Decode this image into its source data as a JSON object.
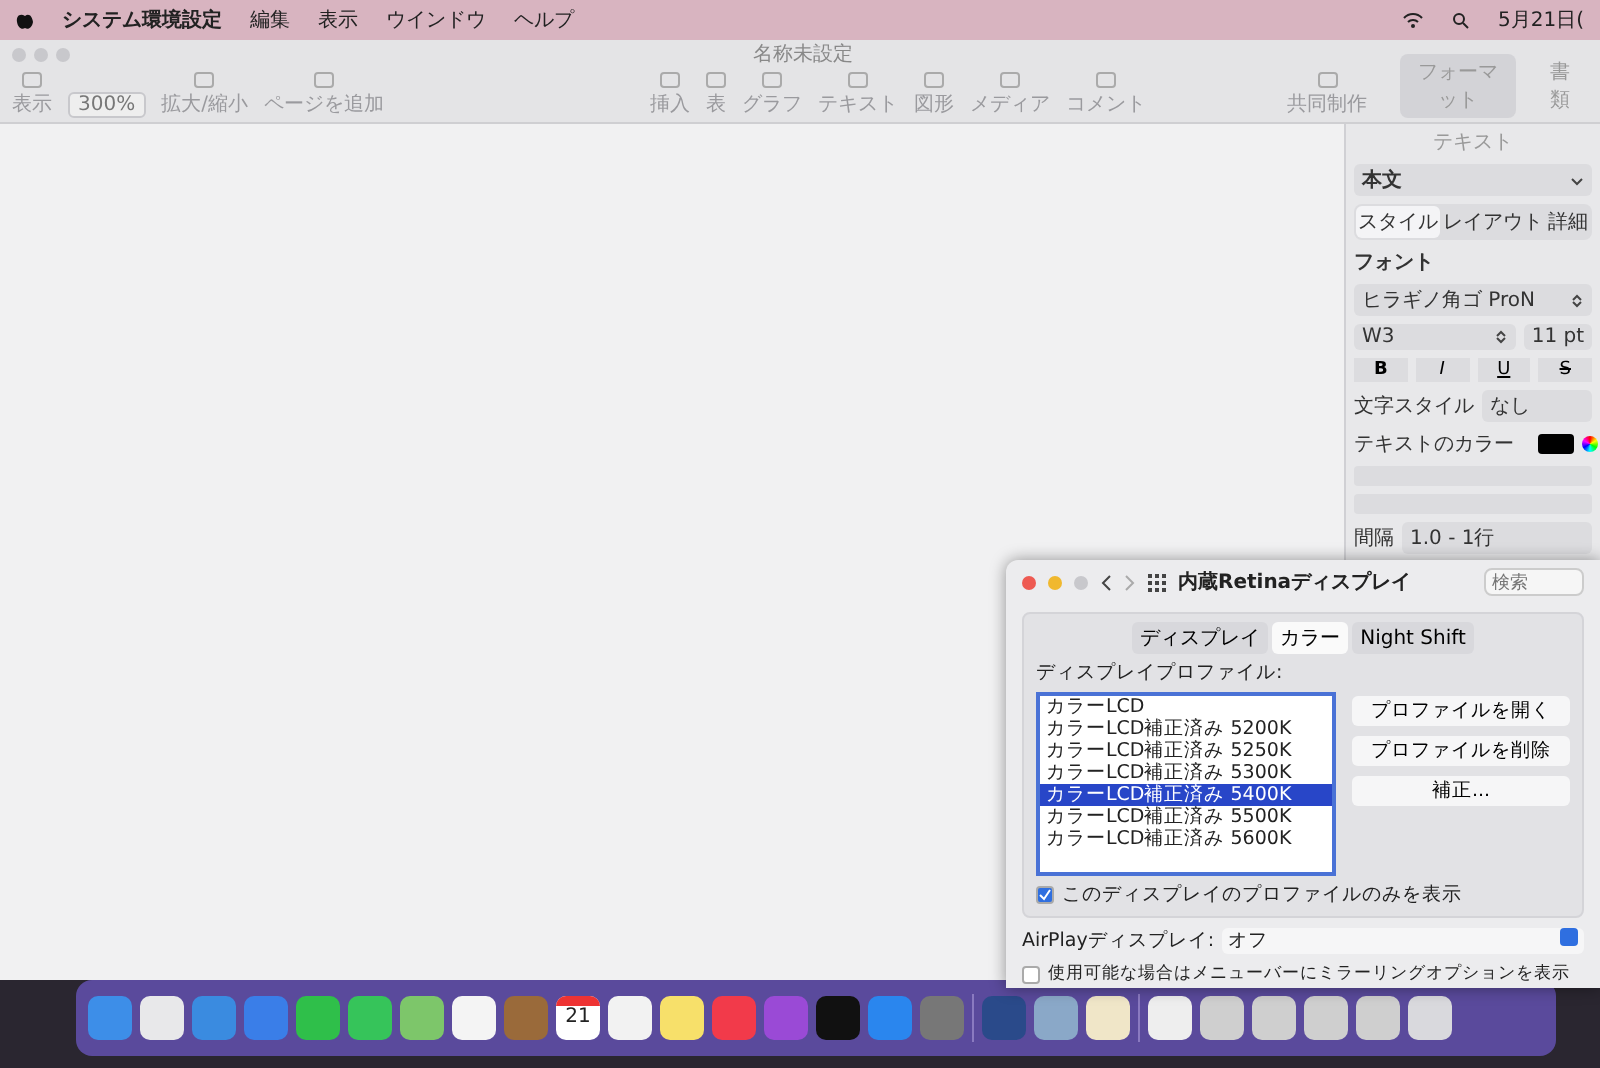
{
  "menu_bar": {
    "items": [
      {
        "label": "システム環境設定",
        "bold": true
      },
      {
        "label": "編集",
        "bold": false
      },
      {
        "label": "表示",
        "bold": false
      },
      {
        "label": "ウインドウ",
        "bold": false
      },
      {
        "label": "ヘルプ",
        "bold": false
      }
    ],
    "clock": "5月21日("
  },
  "document_window": {
    "title": "名称未設定",
    "zoom": "300%",
    "left_tools": [
      {
        "label": "表示"
      },
      {
        "label": "拡大/縮小"
      },
      {
        "label": "ページを追加"
      }
    ],
    "tools": [
      {
        "label": "挿入"
      },
      {
        "label": "表"
      },
      {
        "label": "グラフ"
      },
      {
        "label": "テキスト"
      },
      {
        "label": "図形"
      },
      {
        "label": "メディア"
      },
      {
        "label": "コメント"
      }
    ],
    "collaborate": "共同制作",
    "panel_tabs": [
      {
        "label": "フォーマット",
        "selected": true
      },
      {
        "label": "書類",
        "selected": false
      }
    ]
  },
  "inspector": {
    "tab": "テキスト",
    "paragraph_style": "本文",
    "segments": [
      {
        "label": "スタイル",
        "selected": true
      },
      {
        "label": "レイアウト",
        "selected": false
      },
      {
        "label": "詳細",
        "selected": false
      }
    ],
    "font_heading": "フォント",
    "font_family": "ヒラギノ角ゴ ProN",
    "typeface": "W3",
    "size": "11 pt",
    "styles": [
      "B",
      "I",
      "U",
      "S"
    ],
    "char_style_label": "文字スタイル",
    "char_style": "なし",
    "color_label": "テキストのカラー",
    "spacing_label": "間隔",
    "spacing": "1.0 - 1行"
  },
  "preferences": {
    "title": "内蔵Retinaディスプレイ",
    "search_placeholder": "検索",
    "tabs": [
      {
        "label": "ディスプレイ",
        "selected": false
      },
      {
        "label": "カラー",
        "selected": true
      },
      {
        "label": "Night Shift",
        "selected": false
      }
    ],
    "profile_label": "ディスプレイプロファイル:",
    "profiles": [
      {
        "label": "カラーLCD",
        "selected": false
      },
      {
        "label": "カラーLCD補正済み 5200K",
        "selected": false
      },
      {
        "label": "カラーLCD補正済み 5250K",
        "selected": false
      },
      {
        "label": "カラーLCD補正済み 5300K",
        "selected": false
      },
      {
        "label": "カラーLCD補正済み 5400K",
        "selected": true
      },
      {
        "label": "カラーLCD補正済み 5500K",
        "selected": false
      },
      {
        "label": "カラーLCD補正済み 5600K",
        "selected": false
      }
    ],
    "buttons": [
      "プロファイルを開く",
      "プロファイルを削除",
      "補正..."
    ],
    "only_this": {
      "label": "このディスプレイのプロファイルのみを表示",
      "checked": true
    },
    "airplay_label": "AirPlayディスプレイ:",
    "airplay_value": "オフ",
    "mirroring": {
      "label": "使用可能な場合はメニューバーにミラーリングオプションを表示",
      "checked": false
    }
  },
  "dock": {
    "calendar_day": "21",
    "items": [
      {
        "kind": "finder"
      },
      {
        "kind": "grid"
      },
      {
        "kind": "compass"
      },
      {
        "kind": "mail"
      },
      {
        "kind": "video"
      },
      {
        "kind": "chat"
      },
      {
        "kind": "map"
      },
      {
        "kind": "flower"
      },
      {
        "kind": "book"
      },
      {
        "kind": "calendar"
      },
      {
        "kind": "list"
      },
      {
        "kind": "note"
      },
      {
        "kind": "music"
      },
      {
        "kind": "podcast"
      },
      {
        "kind": "tv"
      },
      {
        "kind": "store"
      },
      {
        "kind": "gear"
      },
      {
        "kind": "divider"
      },
      {
        "kind": "viewer"
      },
      {
        "kind": "photo"
      },
      {
        "kind": "pencil"
      },
      {
        "kind": "divider"
      },
      {
        "kind": "document"
      },
      {
        "kind": "thumbnail"
      },
      {
        "kind": "thumbnail"
      },
      {
        "kind": "thumbnail"
      },
      {
        "kind": "thumbnail"
      },
      {
        "kind": "trash"
      }
    ]
  }
}
